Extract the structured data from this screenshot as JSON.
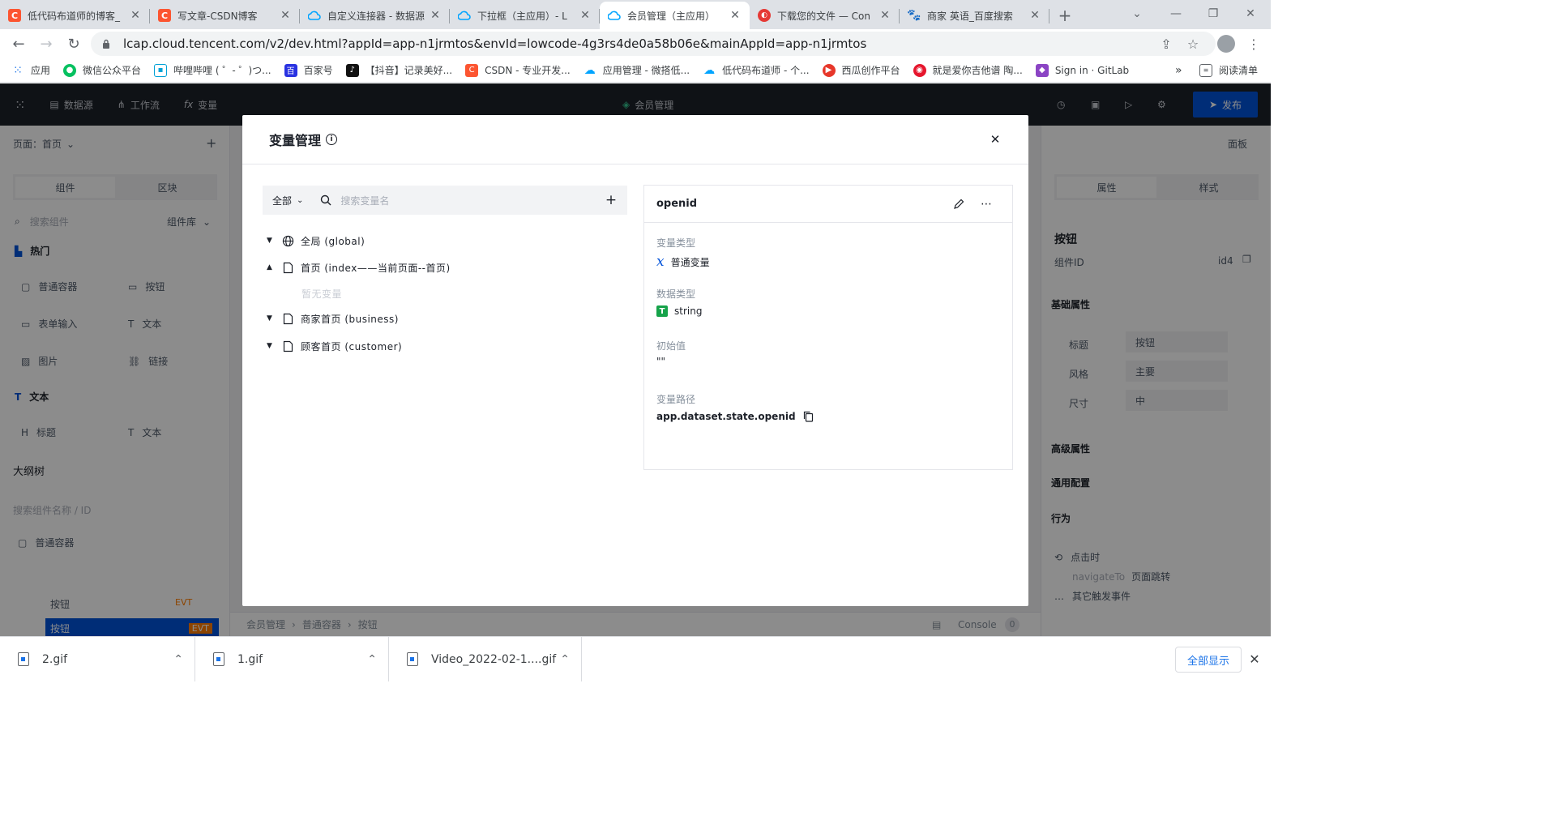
{
  "browser": {
    "tabs": [
      {
        "title": "低代码布道师的博客_",
        "icon": "csdn-icon",
        "color": "#fc5531"
      },
      {
        "title": "写文章-CSDN博客",
        "icon": "csdn-icon",
        "color": "#fc5531"
      },
      {
        "title": "自定义连接器 - 数据源",
        "icon": "cloud-icon",
        "color": "#0052d9"
      },
      {
        "title": "下拉框（主应用）- L",
        "icon": "cloud-icon",
        "color": "#0052d9"
      },
      {
        "title": "会员管理（主应用）",
        "icon": "cloud-icon",
        "color": "#0052d9",
        "active": true
      },
      {
        "title": "下载您的文件 — Con",
        "icon": "convertio-icon",
        "color": "#e53935"
      },
      {
        "title": "商家 英语_百度搜索",
        "icon": "baidu-icon",
        "color": "#2932e1"
      }
    ],
    "url": "lcap.cloud.tencent.com/v2/dev.html?appId=app-n1jrmtos&envId=lowcode-4g3rs4de0a58b06e&mainAppId=app-n1jrmtos",
    "bookmarks": [
      {
        "label": "应用",
        "icon": "apps-grid-icon"
      },
      {
        "label": "微信公众平台",
        "icon": "wechat-icon"
      },
      {
        "label": "哔哩哔哩 ( ゜- ゜)つ...",
        "icon": "bilibili-icon"
      },
      {
        "label": "百家号",
        "icon": "baijiahao-icon"
      },
      {
        "label": "【抖音】记录美好...",
        "icon": "douyin-icon"
      },
      {
        "label": "CSDN - 专业开发...",
        "icon": "csdn-icon"
      },
      {
        "label": "应用管理 - 微搭低...",
        "icon": "cloud-icon"
      },
      {
        "label": "低代码布道师 - 个...",
        "icon": "cloud-icon"
      },
      {
        "label": "西瓜创作平台",
        "icon": "xigua-icon"
      },
      {
        "label": "就是爱你吉他谱 陶...",
        "icon": "weibo-icon"
      },
      {
        "label": "Sign in · GitLab",
        "icon": "gitlab-icon"
      }
    ],
    "more": "»",
    "reading_list": "阅读清单"
  },
  "app": {
    "toolbar": {
      "datasource": "数据源",
      "workflow": "工作流",
      "variable": "变量",
      "app_name": "会员管理",
      "publish": "发布"
    },
    "left_panel": {
      "page_label": "页面：首页",
      "tabs": [
        "组件",
        "区块"
      ],
      "search_placeholder": "搜索组件",
      "library": "组件库",
      "hot": "热门",
      "components": [
        "普通容器",
        "按钮",
        "表单输入",
        "文本",
        "图片",
        "链接"
      ],
      "text_group": "文本",
      "text_items": [
        "标题",
        "文本"
      ],
      "outline": "大纲树",
      "outline_search": "搜索组件名称 / ID",
      "outline_items": [
        "普通容器",
        "按钮",
        "按钮"
      ],
      "evt": "EVT"
    },
    "right_panel": {
      "panel": "面板",
      "tabs": [
        "属性",
        "样式"
      ],
      "component": "按钮",
      "component_id_label": "组件ID",
      "component_id": "id4",
      "basic": "基础属性",
      "props": [
        {
          "label": "标题",
          "value": "按钮"
        },
        {
          "label": "风格",
          "value": "主要"
        },
        {
          "label": "尺寸",
          "value": "中"
        }
      ],
      "advanced": "高级属性",
      "general": "通用配置",
      "behavior": "行为",
      "on_click": "点击时",
      "action": "navigateTo",
      "action_desc": "页面跳转",
      "other_events": "其它触发事件"
    },
    "breadcrumb": [
      "会员管理",
      "普通容器",
      "按钮"
    ],
    "console": "Console",
    "console_count": "0"
  },
  "modal": {
    "title": "变量管理",
    "filter": "全部",
    "search_placeholder": "搜索变量名",
    "tree": [
      {
        "label": "全局 (global)",
        "icon": "globe-icon",
        "expanded": false
      },
      {
        "label": "首页 (index——当前页面--首页)",
        "icon": "page-icon",
        "expanded": true,
        "empty": "暂无变量"
      },
      {
        "label": "商家首页 (business)",
        "icon": "page-icon",
        "expanded": false
      },
      {
        "label": "顾客首页 (customer)",
        "icon": "page-icon",
        "expanded": false
      }
    ],
    "detail": {
      "name": "openid",
      "var_type_label": "变量类型",
      "var_type": "普通变量",
      "data_type_label": "数据类型",
      "data_type": "string",
      "initial_label": "初始值",
      "initial_value": "\"\"",
      "path_label": "变量路径",
      "path": "app.dataset.state.openid"
    }
  },
  "downloads": {
    "items": [
      "2.gif",
      "1.gif",
      "Video_2022-02-1....gif"
    ],
    "show_all": "全部显示"
  }
}
